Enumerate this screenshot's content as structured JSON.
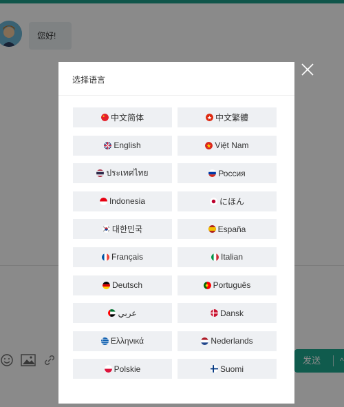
{
  "chat": {
    "greeting": "您好!",
    "send_label": "发送",
    "send_extra": "^"
  },
  "modal": {
    "title": "选择语言"
  },
  "languages": [
    {
      "label": "中文简体",
      "flag": "china"
    },
    {
      "label": "中文繁體",
      "flag": "hongkong"
    },
    {
      "label": "English",
      "flag": "uk"
    },
    {
      "label": "Việt Nam",
      "flag": "vietnam"
    },
    {
      "label": "ประเทศไทย",
      "flag": "thailand"
    },
    {
      "label": "Россия",
      "flag": "russia"
    },
    {
      "label": "Indonesia",
      "flag": "indonesia"
    },
    {
      "label": "にほん",
      "flag": "japan"
    },
    {
      "label": "대한민국",
      "flag": "korea"
    },
    {
      "label": "España",
      "flag": "spain"
    },
    {
      "label": "Français",
      "flag": "france"
    },
    {
      "label": "Italian",
      "flag": "italy"
    },
    {
      "label": "Deutsch",
      "flag": "germany"
    },
    {
      "label": "Português",
      "flag": "portugal"
    },
    {
      "label": "عربي",
      "flag": "uae"
    },
    {
      "label": "Dansk",
      "flag": "denmark"
    },
    {
      "label": "Ελληνικά",
      "flag": "greece"
    },
    {
      "label": "Nederlands",
      "flag": "netherlands"
    },
    {
      "label": "Polskie",
      "flag": "poland"
    },
    {
      "label": "Suomi",
      "flag": "finland"
    }
  ],
  "colors": {
    "accent": "#1ea88f",
    "button_bg": "#eef0f3"
  }
}
